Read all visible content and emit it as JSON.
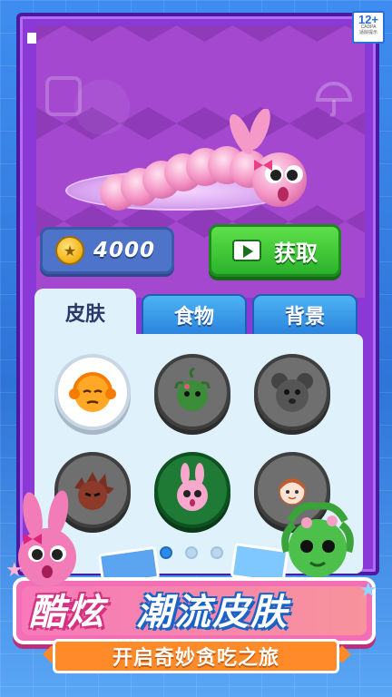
{
  "age_rating": {
    "value": "12+",
    "org": "CADPA",
    "label": "适龄提示"
  },
  "coins": {
    "amount": "4000"
  },
  "get_button": {
    "label": "获取"
  },
  "tabs": [
    {
      "label": "皮肤",
      "active": true
    },
    {
      "label": "食物",
      "active": false
    },
    {
      "label": "背景",
      "active": false
    }
  ],
  "skins": [
    {
      "icon": "orange-headphone-face-icon",
      "selected": true
    },
    {
      "icon": "green-vine-monster-icon",
      "selected": false
    },
    {
      "icon": "gray-mouse-icon",
      "selected": false
    },
    {
      "icon": "spiky-brown-creature-icon",
      "selected": false
    },
    {
      "icon": "pink-bunny-icon",
      "selected": true
    },
    {
      "icon": "sketch-girl-icon",
      "selected": false
    }
  ],
  "pagination": {
    "current": 1,
    "total": 3
  },
  "banner": {
    "title_left": "酷炫",
    "title_right": "潮流皮肤",
    "subtitle": "开启奇妙贪吃之旅"
  },
  "colors": {
    "frame": "#8a38d6",
    "accent_green": "#2ab22a",
    "tab_blue": "#2a84dc",
    "banner_pink": "#f36fb5",
    "subtitle_orange": "#ff8a2a"
  }
}
